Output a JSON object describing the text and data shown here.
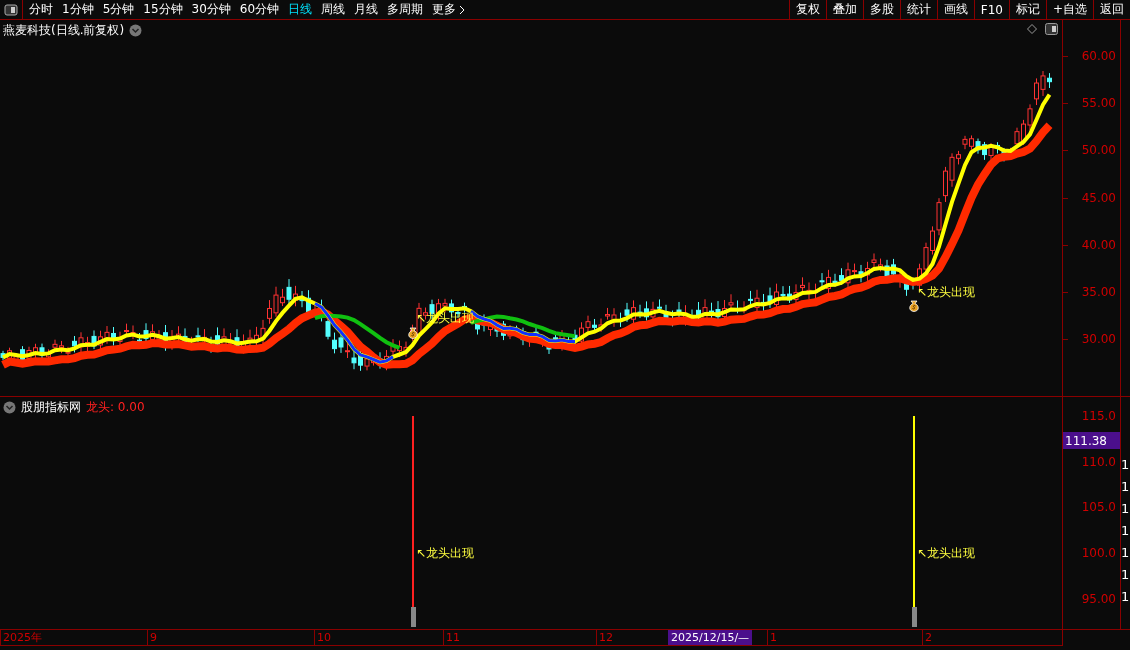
{
  "toolbar": {
    "periods": [
      {
        "label": "分时",
        "selected": false
      },
      {
        "label": "1分钟",
        "selected": false
      },
      {
        "label": "5分钟",
        "selected": false
      },
      {
        "label": "15分钟",
        "selected": false
      },
      {
        "label": "30分钟",
        "selected": false
      },
      {
        "label": "60分钟",
        "selected": false
      },
      {
        "label": "日线",
        "selected": true
      },
      {
        "label": "周线",
        "selected": false
      },
      {
        "label": "月线",
        "selected": false
      },
      {
        "label": "多周期",
        "selected": false
      },
      {
        "label": "更多",
        "selected": false
      }
    ],
    "actions": [
      "复权",
      "叠加",
      "多股",
      "统计",
      "画线",
      "F10",
      "标记",
      "+自选",
      "返回"
    ]
  },
  "main_chart": {
    "title": "燕麦科技(日线.前复权)",
    "y_ticks": [
      "60.00",
      "55.00",
      "50.00",
      "45.00",
      "40.00",
      "35.00",
      "30.00"
    ],
    "signals": [
      {
        "label": "↖龙头出现"
      },
      {
        "label": "↖龙头出现"
      }
    ]
  },
  "indicator": {
    "name": "股朋指标网",
    "reading": "龙头: 0.00",
    "y_ticks": [
      "115.0",
      "110.0",
      "105.0",
      "100.0",
      "95.00"
    ],
    "current": "111.38",
    "signals": [
      {
        "label": "↖龙头出现",
        "color": "#ff2020"
      },
      {
        "label": "↖龙头出现",
        "color": "#ffff00"
      }
    ],
    "side_column": [
      "1",
      "1",
      "1",
      "1",
      "1",
      "1",
      "1"
    ]
  },
  "date_axis": {
    "labels": [
      "2025年",
      "9",
      "10",
      "11",
      "12",
      "1",
      "2"
    ],
    "cursor": "2025/12/15/—"
  }
}
